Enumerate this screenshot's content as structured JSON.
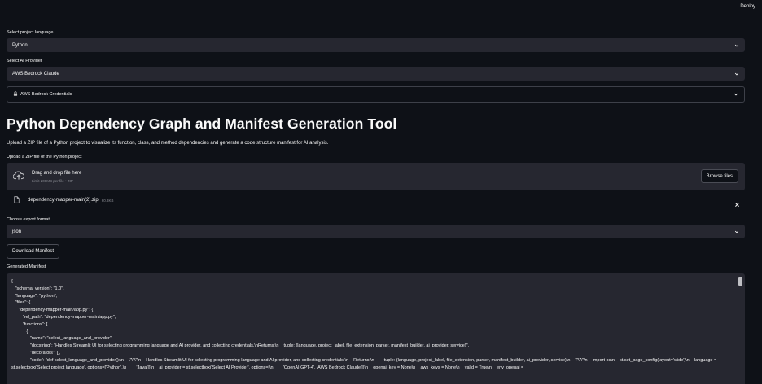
{
  "header": {
    "deploy_label": "Deploy"
  },
  "language_select": {
    "label": "Select project language",
    "value": "Python"
  },
  "provider_select": {
    "label": "Select AI Provider",
    "value": "AWS Bedrock Claude"
  },
  "credentials_expander": {
    "label": "AWS Bedrock Credentials",
    "icon": "lock-icon"
  },
  "main": {
    "title": "Python Dependency Graph and Manifest Generation Tool",
    "description": "Upload a ZIP file of a Python project to visualize its function, class, and method dependencies and generate a code structure manifest for AI analysis."
  },
  "uploader": {
    "label": "Upload a ZIP file of the Python project",
    "drop_text": "Drag and drop file here",
    "limit_text": "Limit 200MB per file • ZIP",
    "browse_label": "Browse files",
    "file_name": "dependency-mapper-main(2).zip",
    "file_size": "60.3KB"
  },
  "export_select": {
    "label": "Choose export format",
    "value": "json"
  },
  "download_button": {
    "label": "Download Manifest"
  },
  "manifest": {
    "label": "Generated Manifest",
    "content": "{\n   \"schema_version\": \"1.0\",\n   \"language\": \"python\",\n   \"files\": {\n      \"dependency-mapper-main/app.py\": {\n         \"rel_path\": \"dependency-mapper-main/app.py\",\n         \"functions\": [\n            {\n               \"name\": \"select_language_and_provider\",\n               \"docstring\": \"Handles Streamlit UI for selecting programming language and AI provider, and collecting credentials.\\nReturns:\\n    tuple: (language, project_label, file_extension, parser, manifest_builder, ai_provider, service)\",\n               \"decorators\": [],\n               \"code\": \"def select_language_and_provider():\\n    \\\"\\\"\\\"\\n    Handles Streamlit UI for selecting programming language and AI provider, and collecting credentials.\\n    Returns:\\n        tuple: (language, project_label, file_extension, parser, manifest_builder, ai_provider, service)\\n    \\\"\\\"\\\"\\n    import os\\n    st.set_page_config(layout='wide')\\n    language = st.selectbox('Select project language', options=['Python',\\n        'Java'])\\n    ai_provider = st.selectbox('Select AI Provider', options=[\\n        'OpenAI GPT-4', 'AWS Bedrock Claude'])\\n    openai_key = None\\n    aws_keys = None\\n    valid = True\\n    env_openai ="
  }
}
